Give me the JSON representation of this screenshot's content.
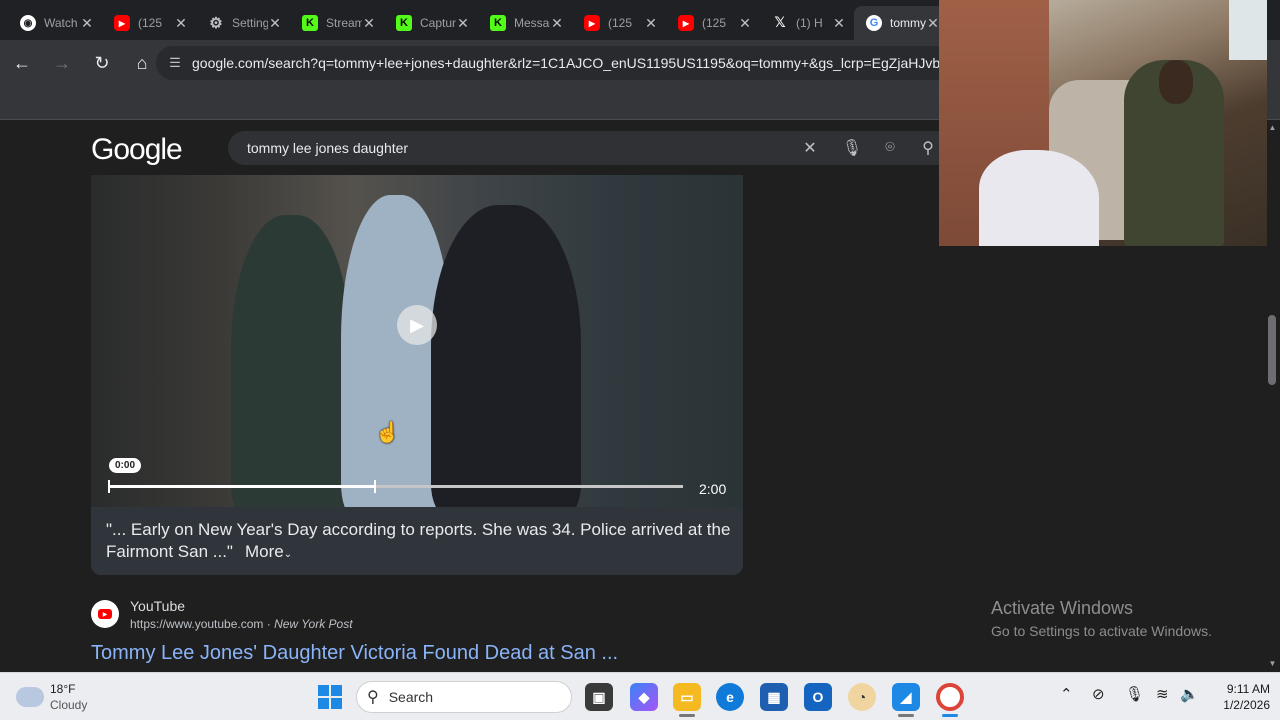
{
  "browser": {
    "tabs": [
      {
        "title": "Watch",
        "icon": "watch-icon"
      },
      {
        "title": "(125",
        "icon": "youtube-icon"
      },
      {
        "title": "Settings",
        "icon": "gear-icon"
      },
      {
        "title": "Stream",
        "icon": "kick-icon"
      },
      {
        "title": "Capture",
        "icon": "kick-icon"
      },
      {
        "title": "Messages",
        "icon": "kick-icon"
      },
      {
        "title": "(125",
        "icon": "youtube-icon"
      },
      {
        "title": "(125",
        "icon": "youtube-icon"
      },
      {
        "title": "(1) H",
        "icon": "x-icon"
      },
      {
        "title": "tommy",
        "icon": "google-icon"
      }
    ],
    "active_tab_index": 9,
    "url": "google.com/search?q=tommy+lee+jones+daughter&rlz=1C1AJCO_enUS1195US1195&oq=tommy+&gs_lcrp=EgZjaHJvb"
  },
  "google": {
    "logo": "Google",
    "query": "tommy lee jones daughter"
  },
  "video": {
    "current_time": "0:00",
    "duration": "2:00",
    "progress_fraction": 0.465,
    "caption": "\"... Early on New Year's Day according to reports. She was 34. Police arrived at the Fairmont San ...\"",
    "more_label": "More"
  },
  "result": {
    "site_name": "YouTube",
    "url": "https://www.youtube.com",
    "source": "New York Post",
    "url_separator": " · ",
    "title": "Tommy Lee Jones' Daughter Victoria Found Dead at San ..."
  },
  "watermark": {
    "title": "Activate Windows",
    "subtitle": "Go to Settings to activate Windows."
  },
  "taskbar": {
    "weather_temp": "18°F",
    "weather_cond": "Cloudy",
    "search_label": "Search",
    "time": "9:11 AM",
    "date": "1/2/2026"
  },
  "colors": {
    "link": "#8ab4f8",
    "youtube_red": "#ff0000",
    "kick_green": "#53fc18"
  }
}
